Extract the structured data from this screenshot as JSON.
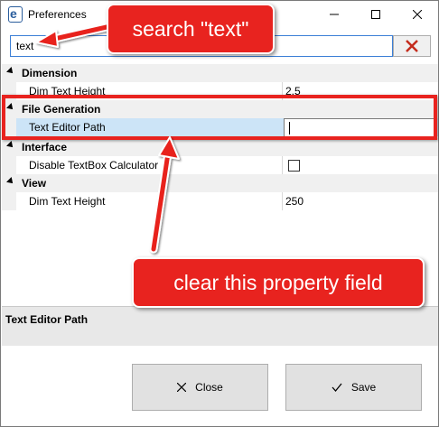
{
  "window": {
    "title": "Preferences"
  },
  "search": {
    "value": "text"
  },
  "grid": {
    "categories": [
      {
        "label": "Dimension",
        "rows": [
          {
            "name": "Dim Text Height",
            "value": "2.5"
          }
        ]
      },
      {
        "label": "File Generation",
        "rows": [
          {
            "name": "Text Editor Path",
            "value": ""
          }
        ]
      },
      {
        "label": "Interface",
        "rows": [
          {
            "name": "Disable TextBox Calculator",
            "checked": false
          }
        ]
      },
      {
        "label": "View",
        "rows": [
          {
            "name": "Dim Text Height",
            "value": "250"
          }
        ]
      }
    ]
  },
  "description": {
    "title": "Text Editor Path"
  },
  "buttons": {
    "close_label": "Close",
    "save_label": "Save"
  },
  "annotations": {
    "search_callout": "search \"text\"",
    "clear_callout": "clear this property field",
    "color": "#e8231f"
  },
  "icons": {
    "app": "app-e-icon",
    "minimize": "minimize-icon",
    "maximize": "maximize-icon",
    "close": "close-icon",
    "clear_search": "red-x-icon",
    "close_button": "x-icon",
    "save_button": "checkmark-icon"
  }
}
